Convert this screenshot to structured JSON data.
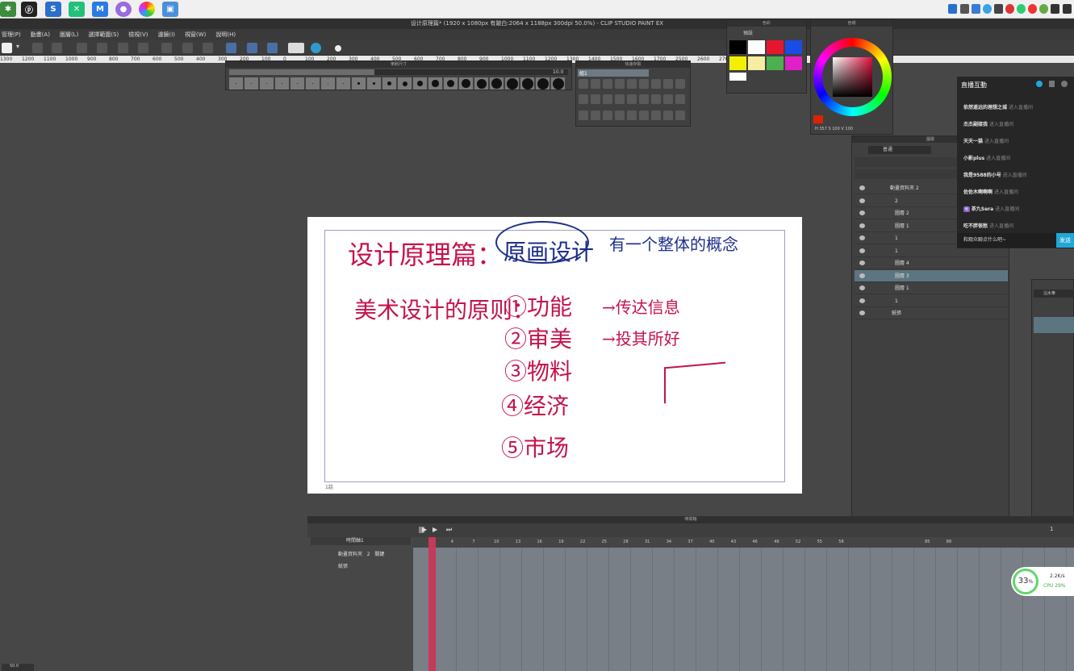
{
  "window": {
    "title": "设计原理篇* (1920 x 1080px 有跛白:2064 x 1188px 300dpi 50.0%) - CLIP STUDIO PAINT EX"
  },
  "menu": [
    "管理(P)",
    "動畫(A)",
    "圖層(L)",
    "選擇範圍(S)",
    "檢視(V)",
    "濾鏡(I)",
    "視窗(W)",
    "說明(H)"
  ],
  "ruler_ticks": [
    "1300",
    "1200",
    "1100",
    "1000",
    "900",
    "800",
    "700",
    "600",
    "500",
    "400",
    "300",
    "200",
    "100",
    "0",
    "100",
    "200",
    "300",
    "400",
    "500",
    "600",
    "700",
    "800",
    "900",
    "1000",
    "1100",
    "1200",
    "1300",
    "1400",
    "1500",
    "1600",
    "1700",
    "2500",
    "2600",
    "2700",
    "2800",
    "2900"
  ],
  "brush_size": {
    "title": "筆刷尺寸",
    "value": "10.0"
  },
  "quick_access": {
    "title": "快速存取",
    "tab": "組1"
  },
  "color_set": {
    "title": "色彩",
    "set_name": "預設",
    "colors": [
      "#000000",
      "#ffffff",
      "#e6162d",
      "#1a4ce6",
      "#f2f000",
      "#f5eda0",
      "#4caf50",
      "#e020c8"
    ]
  },
  "color_wheel": {
    "title": "色環",
    "readout": "H 357  S 100  V 100"
  },
  "layers": {
    "title": "圖層",
    "blend": "普通",
    "rows": [
      {
        "name": "動畫資料夾",
        "count": "2"
      },
      {
        "name": "2"
      },
      {
        "name": "圖層 2"
      },
      {
        "name": "圖層 1"
      },
      {
        "name": "1"
      },
      {
        "name": "1"
      },
      {
        "name": "圖層 4"
      },
      {
        "name": "圖層 3"
      },
      {
        "name": "圖層 1"
      },
      {
        "name": "1"
      },
      {
        "name": "紙張"
      }
    ]
  },
  "canvas": {
    "heading": "设计原理篇：",
    "circled": "原画设计",
    "concept": "有一个整体的概念",
    "principles_label": "美术设计的原则：",
    "principles": [
      "①功能",
      "②审美",
      "③物料",
      "④经济",
      "⑤市场"
    ],
    "arrow1": "→传达信息",
    "arrow2": "→投其所好",
    "page_number": "1話"
  },
  "timeline": {
    "title": "時間軸",
    "track_label": "時間軸1",
    "layers": [
      {
        "name": "動畫資料夾",
        "count": "2",
        "mode": "關鍵"
      },
      {
        "name": "紙張"
      }
    ],
    "frames": [
      "1",
      "4",
      "7",
      "10",
      "13",
      "16",
      "19",
      "22",
      "25",
      "28",
      "31",
      "34",
      "37",
      "40",
      "43",
      "46",
      "49",
      "52",
      "55",
      "58",
      "",
      "",
      "",
      "85",
      "88"
    ],
    "right_number": "1"
  },
  "live": {
    "title": "直播互動",
    "messages": [
      {
        "user": "依然遥远的理想之城",
        "action": "进入直播间"
      },
      {
        "user": "杰杰副接我",
        "action": "进入直播间"
      },
      {
        "user": "天天一猫",
        "action": "进入直播间"
      },
      {
        "user": "小影plus",
        "action": "进入直播间"
      },
      {
        "user": "我是9588的小号",
        "action": "进入直播间"
      },
      {
        "user": "佐佐木啊啊啊",
        "action": "进入直播间"
      },
      {
        "user": "茶九Sera",
        "action": "进入直播间",
        "badge": "6"
      },
      {
        "user": "吃不胖很愁",
        "action": "进入直播间"
      }
    ],
    "input_placeholder": "和观众聊点什么吧~",
    "send": "发送"
  },
  "sub_tool": {
    "name": "沾水筆"
  },
  "perf": {
    "cpu_percent": "33",
    "unit": "%",
    "net_speed": "2.2K/s",
    "cpu_label": "CPU",
    "cpu_val": "29%"
  },
  "status_zoom": "50.0"
}
